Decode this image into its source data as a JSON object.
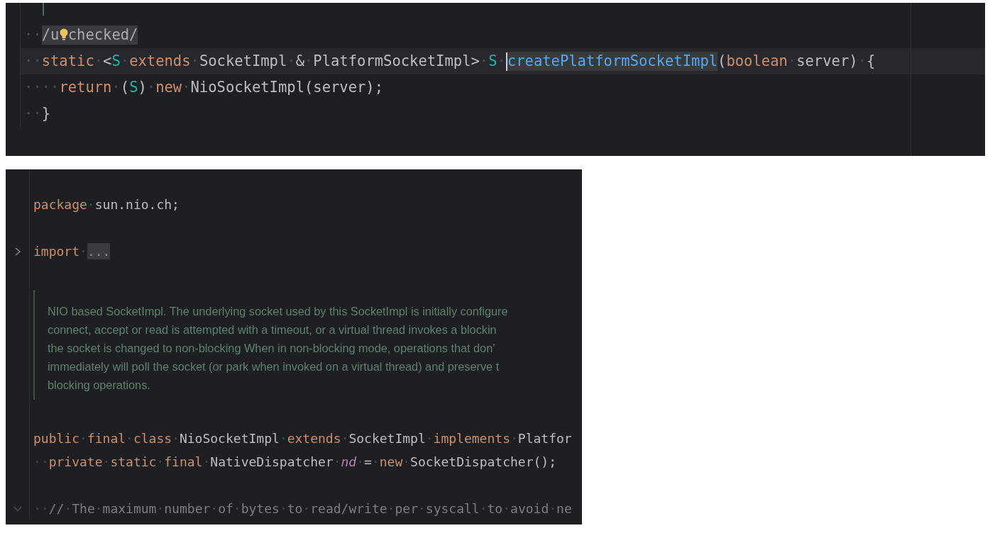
{
  "top_editor": {
    "lines": [
      {
        "kind": "code",
        "current": false,
        "tokens": [
          {
            "kind": "ws",
            "text": "··"
          },
          {
            "kind": "ann",
            "text": "/u"
          },
          {
            "kind": "bulb"
          },
          {
            "kind": "ann",
            "text": "checked/"
          }
        ]
      },
      {
        "kind": "code",
        "current": true,
        "tokens": [
          {
            "kind": "ws",
            "text": "··"
          },
          {
            "kind": "kw",
            "text": "static"
          },
          {
            "kind": "ws",
            "text": "·"
          },
          {
            "kind": "id",
            "text": "<"
          },
          {
            "kind": "tp",
            "text": "S"
          },
          {
            "kind": "ws",
            "text": "·"
          },
          {
            "kind": "kw",
            "text": "extends"
          },
          {
            "kind": "ws",
            "text": "·"
          },
          {
            "kind": "id",
            "text": "SocketImpl"
          },
          {
            "kind": "ws",
            "text": "·"
          },
          {
            "kind": "id",
            "text": "&"
          },
          {
            "kind": "ws",
            "text": "·"
          },
          {
            "kind": "id",
            "text": "PlatformSocketImpl>"
          },
          {
            "kind": "ws",
            "text": "·"
          },
          {
            "kind": "tp",
            "text": "S"
          },
          {
            "kind": "ws",
            "text": "·"
          },
          {
            "kind": "caret"
          },
          {
            "kind": "usage",
            "text": "createPlatformSocketImpl"
          },
          {
            "kind": "id",
            "text": "("
          },
          {
            "kind": "kw",
            "text": "boolean"
          },
          {
            "kind": "ws",
            "text": "·"
          },
          {
            "kind": "id",
            "text": "server)"
          },
          {
            "kind": "ws",
            "text": "·"
          },
          {
            "kind": "id",
            "text": "{"
          }
        ]
      },
      {
        "kind": "code",
        "current": false,
        "tokens": [
          {
            "kind": "ws",
            "text": "····"
          },
          {
            "kind": "kw",
            "text": "return"
          },
          {
            "kind": "ws",
            "text": "·"
          },
          {
            "kind": "id",
            "text": "("
          },
          {
            "kind": "tp",
            "text": "S"
          },
          {
            "kind": "id",
            "text": ")"
          },
          {
            "kind": "ws",
            "text": "·"
          },
          {
            "kind": "kw",
            "text": "new"
          },
          {
            "kind": "ws",
            "text": "·"
          },
          {
            "kind": "id",
            "text": "NioSocketImpl(server);"
          }
        ]
      },
      {
        "kind": "code",
        "current": false,
        "tokens": [
          {
            "kind": "ws",
            "text": "··"
          },
          {
            "kind": "id",
            "text": "}"
          }
        ]
      }
    ]
  },
  "bottom_editor": {
    "lines": [
      {
        "kind": "blank"
      },
      {
        "kind": "code",
        "current": false,
        "tokens": [
          {
            "kind": "kw",
            "text": "package"
          },
          {
            "kind": "ws",
            "text": "·"
          },
          {
            "kind": "id",
            "text": "sun.nio.ch;"
          }
        ]
      },
      {
        "kind": "blank"
      },
      {
        "kind": "code",
        "current": false,
        "expanded": false,
        "tokens": [
          {
            "kind": "kw",
            "text": "import"
          },
          {
            "kind": "ws",
            "text": "·"
          },
          {
            "kind": "fold",
            "text": "..."
          }
        ]
      },
      {
        "kind": "blank"
      },
      {
        "kind": "doc",
        "text_lines": [
          "NIO based SocketImpl. The underlying socket used by this SocketImpl is initially configure",
          "connect, accept or read is attempted with a timeout, or a virtual thread invokes a blockin",
          "the socket is changed to non-blocking When in non-blocking mode, operations that don'",
          "immediately will poll the socket (or park when invoked on a virtual thread) and preserve t",
          "blocking operations."
        ]
      },
      {
        "kind": "blank"
      },
      {
        "kind": "code",
        "current": false,
        "tokens": [
          {
            "kind": "kw",
            "text": "public"
          },
          {
            "kind": "ws",
            "text": "·"
          },
          {
            "kind": "kw",
            "text": "final"
          },
          {
            "kind": "ws",
            "text": "·"
          },
          {
            "kind": "kw",
            "text": "class"
          },
          {
            "kind": "ws",
            "text": "·"
          },
          {
            "kind": "id",
            "text": "NioSocketImpl"
          },
          {
            "kind": "ws",
            "text": "·"
          },
          {
            "kind": "kw",
            "text": "extends"
          },
          {
            "kind": "ws",
            "text": "·"
          },
          {
            "kind": "id",
            "text": "SocketImpl"
          },
          {
            "kind": "ws",
            "text": "·"
          },
          {
            "kind": "kw",
            "text": "implements"
          },
          {
            "kind": "ws",
            "text": "·"
          },
          {
            "kind": "id",
            "text": "Platfor"
          }
        ]
      },
      {
        "kind": "code",
        "current": false,
        "tokens": [
          {
            "kind": "ws",
            "text": "··"
          },
          {
            "kind": "kw",
            "text": "private"
          },
          {
            "kind": "ws",
            "text": "·"
          },
          {
            "kind": "kw",
            "text": "static"
          },
          {
            "kind": "ws",
            "text": "·"
          },
          {
            "kind": "kw",
            "text": "final"
          },
          {
            "kind": "ws",
            "text": "·"
          },
          {
            "kind": "id",
            "text": "NativeDispatcher"
          },
          {
            "kind": "ws",
            "text": "·"
          },
          {
            "kind": "fld",
            "text": "nd"
          },
          {
            "kind": "ws",
            "text": "·"
          },
          {
            "kind": "id",
            "text": "="
          },
          {
            "kind": "ws",
            "text": "·"
          },
          {
            "kind": "kw",
            "text": "new"
          },
          {
            "kind": "ws",
            "text": "·"
          },
          {
            "kind": "id",
            "text": "SocketDispatcher();"
          }
        ]
      },
      {
        "kind": "blank"
      },
      {
        "kind": "code",
        "current": false,
        "expanded": true,
        "tokens": [
          {
            "kind": "ws",
            "text": "··"
          },
          {
            "kind": "cm",
            "text": "//"
          },
          {
            "kind": "ws",
            "text": "·"
          },
          {
            "kind": "cm",
            "text": "The"
          },
          {
            "kind": "ws",
            "text": "·"
          },
          {
            "kind": "cm",
            "text": "maximum"
          },
          {
            "kind": "ws",
            "text": "·"
          },
          {
            "kind": "cm",
            "text": "number"
          },
          {
            "kind": "ws",
            "text": "·"
          },
          {
            "kind": "cm",
            "text": "of"
          },
          {
            "kind": "ws",
            "text": "·"
          },
          {
            "kind": "cm",
            "text": "bytes"
          },
          {
            "kind": "ws",
            "text": "·"
          },
          {
            "kind": "cm",
            "text": "to"
          },
          {
            "kind": "ws",
            "text": "·"
          },
          {
            "kind": "cm",
            "text": "read/write"
          },
          {
            "kind": "ws",
            "text": "·"
          },
          {
            "kind": "cm",
            "text": "per"
          },
          {
            "kind": "ws",
            "text": "·"
          },
          {
            "kind": "cm",
            "text": "syscall"
          },
          {
            "kind": "ws",
            "text": "·"
          },
          {
            "kind": "cm",
            "text": "to"
          },
          {
            "kind": "ws",
            "text": "·"
          },
          {
            "kind": "cm",
            "text": "avoid"
          },
          {
            "kind": "ws",
            "text": "·"
          },
          {
            "kind": "cm",
            "text": "ne"
          }
        ]
      }
    ]
  }
}
